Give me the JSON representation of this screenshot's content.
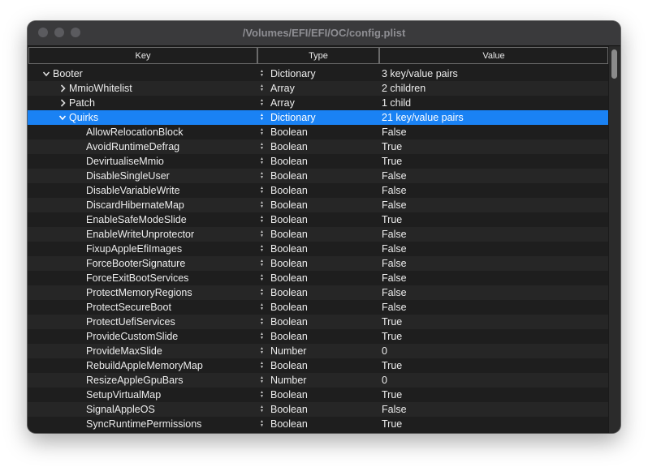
{
  "window": {
    "title": "/Volumes/EFI/EFI/OC/config.plist"
  },
  "columns": {
    "key": "Key",
    "type": "Type",
    "value": "Value"
  },
  "rows": [
    {
      "key": "Booter",
      "type": "Dictionary",
      "value": "3 key/value pairs",
      "disclosure": "v",
      "depth": 0
    },
    {
      "key": "MmioWhitelist",
      "type": "Array",
      "value": "2 children",
      "disclosure": ">",
      "depth": 1
    },
    {
      "key": "Patch",
      "type": "Array",
      "value": "1 child",
      "disclosure": ">",
      "depth": 1
    },
    {
      "key": "Quirks",
      "type": "Dictionary",
      "value": "21 key/value pairs",
      "disclosure": "v",
      "depth": 1,
      "selected": true
    },
    {
      "key": "AllowRelocationBlock",
      "type": "Boolean",
      "value": "False",
      "depth": 2
    },
    {
      "key": "AvoidRuntimeDefrag",
      "type": "Boolean",
      "value": "True",
      "depth": 2
    },
    {
      "key": "DevirtualiseMmio",
      "type": "Boolean",
      "value": "True",
      "depth": 2
    },
    {
      "key": "DisableSingleUser",
      "type": "Boolean",
      "value": "False",
      "depth": 2
    },
    {
      "key": "DisableVariableWrite",
      "type": "Boolean",
      "value": "False",
      "depth": 2
    },
    {
      "key": "DiscardHibernateMap",
      "type": "Boolean",
      "value": "False",
      "depth": 2
    },
    {
      "key": "EnableSafeModeSlide",
      "type": "Boolean",
      "value": "True",
      "depth": 2
    },
    {
      "key": "EnableWriteUnprotector",
      "type": "Boolean",
      "value": "False",
      "depth": 2
    },
    {
      "key": "FixupAppleEfiImages",
      "type": "Boolean",
      "value": "False",
      "depth": 2
    },
    {
      "key": "ForceBooterSignature",
      "type": "Boolean",
      "value": "False",
      "depth": 2
    },
    {
      "key": "ForceExitBootServices",
      "type": "Boolean",
      "value": "False",
      "depth": 2
    },
    {
      "key": "ProtectMemoryRegions",
      "type": "Boolean",
      "value": "False",
      "depth": 2
    },
    {
      "key": "ProtectSecureBoot",
      "type": "Boolean",
      "value": "False",
      "depth": 2
    },
    {
      "key": "ProtectUefiServices",
      "type": "Boolean",
      "value": "True",
      "depth": 2
    },
    {
      "key": "ProvideCustomSlide",
      "type": "Boolean",
      "value": "True",
      "depth": 2
    },
    {
      "key": "ProvideMaxSlide",
      "type": "Number",
      "value": "0",
      "depth": 2
    },
    {
      "key": "RebuildAppleMemoryMap",
      "type": "Boolean",
      "value": "True",
      "depth": 2
    },
    {
      "key": "ResizeAppleGpuBars",
      "type": "Number",
      "value": "0",
      "depth": 2
    },
    {
      "key": "SetupVirtualMap",
      "type": "Boolean",
      "value": "True",
      "depth": 2
    },
    {
      "key": "SignalAppleOS",
      "type": "Boolean",
      "value": "False",
      "depth": 2
    },
    {
      "key": "SyncRuntimePermissions",
      "type": "Boolean",
      "value": "True",
      "depth": 2
    }
  ]
}
